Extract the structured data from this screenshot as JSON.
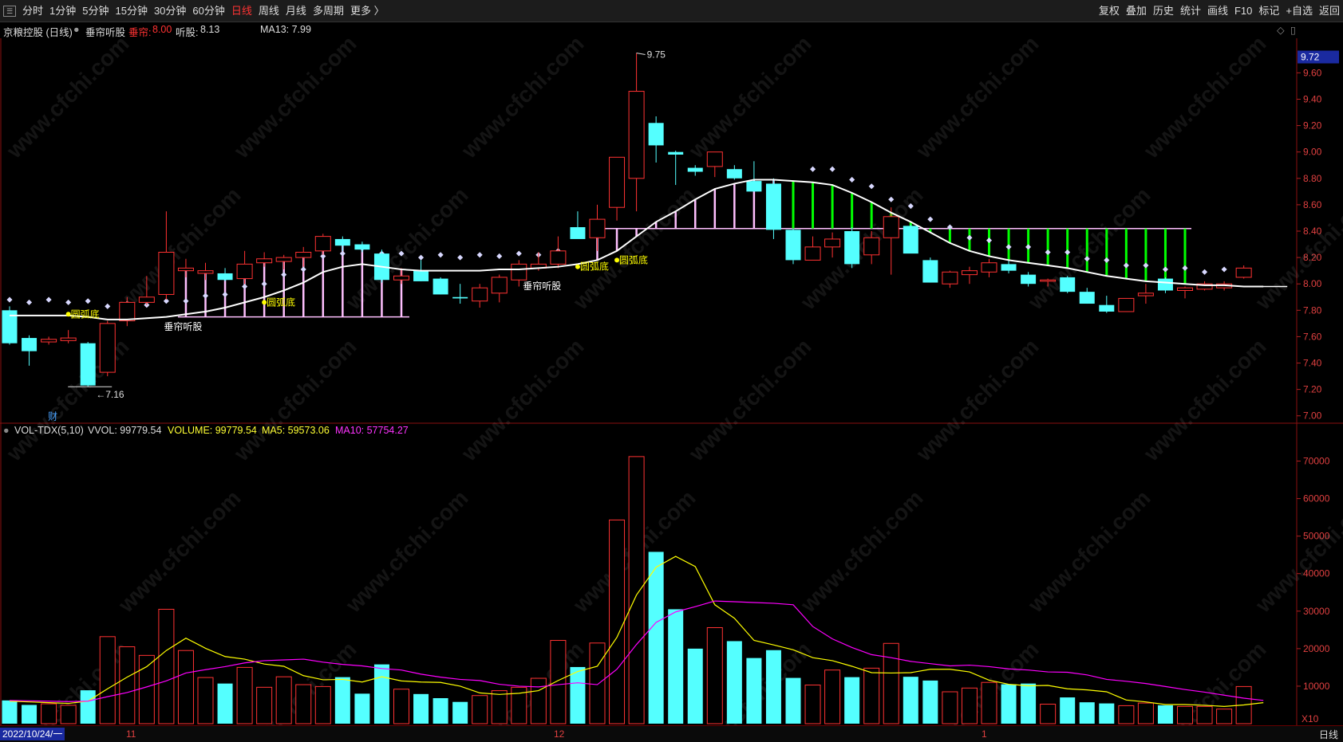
{
  "toolbar": {
    "left": [
      "分时",
      "1分钟",
      "5分钟",
      "15分钟",
      "30分钟",
      "60分钟",
      "日线",
      "周线",
      "月线",
      "多周期",
      "更多 〉"
    ],
    "active": "日线",
    "right": [
      "复权",
      "叠加",
      "历史",
      "统计",
      "画线",
      "F10",
      "标记",
      "+自选",
      "返回"
    ]
  },
  "info": {
    "stock": "京粮控股 (日线)",
    "indicator": "垂帘听股",
    "chuilian_label": "垂帘:",
    "chuilian_value": "8.00",
    "tingu_label": "听股:",
    "tingu_value": "8.13",
    "ma13": "MA13: 7.99"
  },
  "vol_info": {
    "name": "VOL-TDX(5,10)",
    "vvol": "VVOL: 99779.54",
    "volume": "VOLUME: 99779.54",
    "ma5": "MA5: 59573.06",
    "ma10": "MA10: 57754.27"
  },
  "annotations": {
    "high": "9.75",
    "low": "7.16",
    "cai": "财",
    "yuanhudi": "圆弧底",
    "chuilian_tingu": "垂帘听股",
    "current_price": "9.72",
    "x10": "X10"
  },
  "price_axis": [
    "9.60",
    "9.40",
    "9.20",
    "9.00",
    "8.80",
    "8.60",
    "8.40",
    "8.20",
    "8.00",
    "7.80",
    "7.60",
    "7.40",
    "7.20",
    "7.00"
  ],
  "vol_axis": [
    "70000",
    "60000",
    "50000",
    "40000",
    "30000",
    "20000",
    "10000"
  ],
  "bottom": {
    "date": "2022/10/24/一",
    "months": [
      "11",
      "12",
      "1"
    ],
    "period": "日线"
  },
  "watermark": "www.cfchi.com",
  "colors": {
    "up": "#ff3232",
    "down": "#54ffff",
    "ma": "#ffffff",
    "vol_ma5": "#ffff00",
    "vol_ma10": "#ff00ff",
    "green": "#00ff00",
    "pink": "#ffc0ff"
  },
  "chart_data": {
    "type": "candlestick",
    "price_range": [
      6.95,
      9.85
    ],
    "volume_range": [
      0,
      75000
    ],
    "candles": [
      {
        "o": 7.8,
        "h": 7.83,
        "l": 7.54,
        "c": 7.55,
        "v": 6200
      },
      {
        "o": 7.59,
        "h": 7.61,
        "l": 7.38,
        "c": 7.49,
        "v": 5000
      },
      {
        "o": 7.56,
        "h": 7.6,
        "l": 7.54,
        "c": 7.58,
        "v": 5300
      },
      {
        "o": 7.57,
        "h": 7.65,
        "l": 7.55,
        "c": 7.59,
        "v": 4900
      },
      {
        "o": 7.55,
        "h": 7.56,
        "l": 7.22,
        "c": 7.23,
        "v": 8900
      },
      {
        "o": 7.33,
        "h": 7.72,
        "l": 7.3,
        "c": 7.7,
        "v": 23200
      },
      {
        "o": 7.72,
        "h": 7.9,
        "l": 7.68,
        "c": 7.86,
        "v": 20500
      },
      {
        "o": 7.86,
        "h": 8.06,
        "l": 7.84,
        "c": 7.9,
        "v": 18200
      },
      {
        "o": 7.92,
        "h": 8.55,
        "l": 7.88,
        "c": 8.24,
        "v": 30500
      },
      {
        "o": 8.1,
        "h": 8.19,
        "l": 8.05,
        "c": 8.12,
        "v": 19500
      },
      {
        "o": 8.08,
        "h": 8.16,
        "l": 8.03,
        "c": 8.1,
        "v": 12300
      },
      {
        "o": 8.08,
        "h": 8.12,
        "l": 8.02,
        "c": 8.03,
        "v": 10700
      },
      {
        "o": 8.04,
        "h": 8.25,
        "l": 8.0,
        "c": 8.15,
        "v": 15000
      },
      {
        "o": 8.16,
        "h": 8.24,
        "l": 8.13,
        "c": 8.19,
        "v": 9700
      },
      {
        "o": 8.17,
        "h": 8.22,
        "l": 8.11,
        "c": 8.2,
        "v": 12500
      },
      {
        "o": 8.2,
        "h": 8.28,
        "l": 8.13,
        "c": 8.24,
        "v": 10400
      },
      {
        "o": 8.25,
        "h": 8.38,
        "l": 8.22,
        "c": 8.36,
        "v": 9900
      },
      {
        "o": 8.34,
        "h": 8.36,
        "l": 8.25,
        "c": 8.29,
        "v": 12400
      },
      {
        "o": 8.3,
        "h": 8.32,
        "l": 8.24,
        "c": 8.26,
        "v": 8000
      },
      {
        "o": 8.23,
        "h": 8.26,
        "l": 8.01,
        "c": 8.03,
        "v": 15800
      },
      {
        "o": 8.03,
        "h": 8.12,
        "l": 8.0,
        "c": 8.06,
        "v": 9200
      },
      {
        "o": 8.1,
        "h": 8.18,
        "l": 8.02,
        "c": 8.02,
        "v": 7900
      },
      {
        "o": 8.04,
        "h": 8.05,
        "l": 7.92,
        "c": 7.92,
        "v": 6800
      },
      {
        "o": 7.9,
        "h": 8.0,
        "l": 7.85,
        "c": 7.89,
        "v": 5800
      },
      {
        "o": 7.87,
        "h": 8.0,
        "l": 7.82,
        "c": 7.97,
        "v": 7500
      },
      {
        "o": 7.93,
        "h": 8.07,
        "l": 7.86,
        "c": 8.05,
        "v": 8800
      },
      {
        "o": 8.03,
        "h": 8.18,
        "l": 7.98,
        "c": 8.15,
        "v": 9700
      },
      {
        "o": 8.12,
        "h": 8.24,
        "l": 8.1,
        "c": 8.15,
        "v": 12100
      },
      {
        "o": 8.15,
        "h": 8.36,
        "l": 8.12,
        "c": 8.25,
        "v": 22200
      },
      {
        "o": 8.43,
        "h": 8.55,
        "l": 8.38,
        "c": 8.34,
        "v": 15100
      },
      {
        "o": 8.35,
        "h": 8.6,
        "l": 8.25,
        "c": 8.49,
        "v": 21500
      },
      {
        "o": 8.58,
        "h": 8.75,
        "l": 8.48,
        "c": 8.96,
        "v": 54300
      },
      {
        "o": 8.8,
        "h": 9.75,
        "l": 8.55,
        "c": 9.46,
        "v": 71200
      },
      {
        "o": 9.22,
        "h": 9.27,
        "l": 8.92,
        "c": 9.05,
        "v": 45800
      },
      {
        "o": 9.0,
        "h": 9.01,
        "l": 8.75,
        "c": 8.98,
        "v": 30500
      },
      {
        "o": 8.88,
        "h": 8.9,
        "l": 8.82,
        "c": 8.85,
        "v": 20000
      },
      {
        "o": 8.89,
        "h": 9.0,
        "l": 8.81,
        "c": 9.0,
        "v": 25600
      },
      {
        "o": 8.87,
        "h": 8.9,
        "l": 8.79,
        "c": 8.8,
        "v": 22000
      },
      {
        "o": 8.78,
        "h": 8.93,
        "l": 8.7,
        "c": 8.7,
        "v": 17500
      },
      {
        "o": 8.76,
        "h": 8.8,
        "l": 8.34,
        "c": 8.41,
        "v": 19600
      },
      {
        "o": 8.41,
        "h": 8.42,
        "l": 8.15,
        "c": 8.18,
        "v": 12200
      },
      {
        "o": 8.18,
        "h": 8.36,
        "l": 8.18,
        "c": 8.28,
        "v": 10300
      },
      {
        "o": 8.28,
        "h": 8.39,
        "l": 8.2,
        "c": 8.34,
        "v": 14300
      },
      {
        "o": 8.4,
        "h": 8.43,
        "l": 8.12,
        "c": 8.15,
        "v": 12400
      },
      {
        "o": 8.22,
        "h": 8.4,
        "l": 8.15,
        "c": 8.35,
        "v": 14800
      },
      {
        "o": 8.35,
        "h": 8.58,
        "l": 8.07,
        "c": 8.51,
        "v": 21400
      },
      {
        "o": 8.44,
        "h": 8.45,
        "l": 8.24,
        "c": 8.23,
        "v": 12500
      },
      {
        "o": 8.18,
        "h": 8.2,
        "l": 8.01,
        "c": 8.01,
        "v": 11500
      },
      {
        "o": 8.0,
        "h": 8.1,
        "l": 7.97,
        "c": 8.09,
        "v": 8500
      },
      {
        "o": 8.07,
        "h": 8.13,
        "l": 8.0,
        "c": 8.1,
        "v": 9500
      },
      {
        "o": 8.09,
        "h": 8.19,
        "l": 8.05,
        "c": 8.16,
        "v": 11000
      },
      {
        "o": 8.15,
        "h": 8.18,
        "l": 8.08,
        "c": 8.1,
        "v": 10500
      },
      {
        "o": 8.07,
        "h": 8.09,
        "l": 7.98,
        "c": 8.0,
        "v": 10700
      },
      {
        "o": 8.02,
        "h": 8.04,
        "l": 7.98,
        "c": 8.03,
        "v": 5200
      },
      {
        "o": 8.05,
        "h": 8.06,
        "l": 7.93,
        "c": 7.94,
        "v": 7000
      },
      {
        "o": 7.94,
        "h": 7.97,
        "l": 7.85,
        "c": 7.85,
        "v": 5700
      },
      {
        "o": 7.84,
        "h": 7.91,
        "l": 7.78,
        "c": 7.79,
        "v": 5400
      },
      {
        "o": 7.79,
        "h": 7.89,
        "l": 7.79,
        "c": 7.89,
        "v": 4800
      },
      {
        "o": 7.91,
        "h": 8.0,
        "l": 7.85,
        "c": 7.93,
        "v": 5500
      },
      {
        "o": 8.04,
        "h": 8.05,
        "l": 7.93,
        "c": 7.95,
        "v": 4900
      },
      {
        "o": 7.95,
        "h": 7.98,
        "l": 7.89,
        "c": 7.97,
        "v": 4600
      },
      {
        "o": 7.96,
        "h": 8.02,
        "l": 7.95,
        "c": 8.0,
        "v": 4600
      },
      {
        "o": 7.97,
        "h": 8.02,
        "l": 7.95,
        "c": 8.0,
        "v": 3900
      },
      {
        "o": 8.05,
        "h": 8.14,
        "l": 8.04,
        "c": 8.12,
        "v": 9900
      }
    ],
    "ma13": [
      7.76,
      7.76,
      7.76,
      7.76,
      7.75,
      7.73,
      7.73,
      7.74,
      7.75,
      7.77,
      7.79,
      7.82,
      7.86,
      7.9,
      7.95,
      8.01,
      8.09,
      8.13,
      8.15,
      8.13,
      8.11,
      8.1,
      8.1,
      8.1,
      8.1,
      8.11,
      8.11,
      8.12,
      8.13,
      8.15,
      8.18,
      8.25,
      8.36,
      8.47,
      8.55,
      8.64,
      8.72,
      8.76,
      8.79,
      8.79,
      8.78,
      8.77,
      8.75,
      8.69,
      8.62,
      8.54,
      8.47,
      8.39,
      8.31,
      8.25,
      8.21,
      8.18,
      8.16,
      8.14,
      8.12,
      8.09,
      8.06,
      8.04,
      8.02,
      8.01,
      8.0,
      7.99,
      7.99,
      7.98,
      7.98
    ],
    "vol_ma5": [
      6000,
      5800,
      5600,
      5400,
      6000,
      9300,
      12400,
      15200,
      19500,
      22800,
      20100,
      17900,
      17200,
      15900,
      15300,
      12800,
      11700,
      11800,
      11100,
      12500,
      11400,
      11100,
      11000,
      10000,
      8200,
      7800,
      8100,
      8800,
      11500,
      13900,
      15300,
      23000,
      34300,
      41700,
      44600,
      41900,
      31700,
      28100,
      22200,
      21000,
      19700,
      17600,
      16800,
      15300,
      13600,
      13500,
      13600,
      14500,
      14500,
      13800,
      11600,
      10500,
      10100,
      10200,
      9300,
      9000,
      8500,
      6300,
      5800,
      5100,
      5100,
      4900,
      4600,
      5000,
      5600
    ],
    "vol_ma10": [
      6200,
      6100,
      6000,
      5900,
      6000,
      7200,
      8300,
      9800,
      11400,
      13500,
      14400,
      15200,
      16200,
      16800,
      17000,
      17200,
      16400,
      15800,
      15400,
      14700,
      14300,
      13200,
      12400,
      11800,
      11500,
      10500,
      10000,
      9800,
      10400,
      10900,
      10400,
      14500,
      21100,
      27000,
      29800,
      31200,
      32700,
      32500,
      32300,
      32100,
      31700,
      25900,
      22600,
      20300,
      18400,
      17600,
      16600,
      16000,
      15400,
      15600,
      15200,
      14600,
      14300,
      13800,
      13700,
      13000,
      11800,
      11300,
      10700,
      9900,
      9100,
      8400,
      7600,
      6800,
      6200
    ],
    "chuilian_tingu": {
      "zone1": {
        "from": 9,
        "to": 20,
        "bottom": 7.75
      },
      "zone2": {
        "from": 30,
        "to": 40,
        "level": 8.42
      },
      "zone3": {
        "from": 39,
        "to": 60,
        "level": 8.42
      }
    }
  }
}
